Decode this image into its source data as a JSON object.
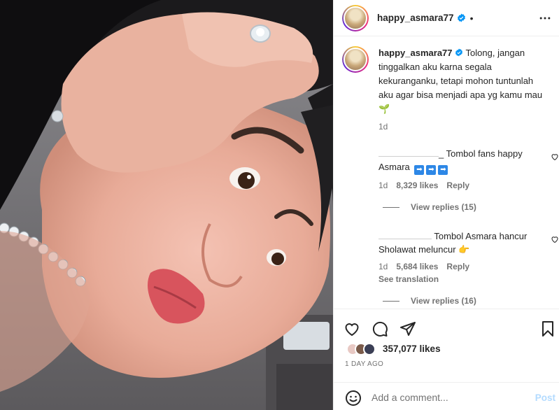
{
  "post": {
    "username": "happy_asmara77",
    "header_separator": "•"
  },
  "caption": {
    "username": "happy_asmara77",
    "text": "Tolong, jangan tinggalkan aku karna segala kekuranganku, tetapi mohon tuntunlah aku agar bisa menjadi apa yg kamu mau",
    "emoji": "🌱",
    "time": "1d"
  },
  "comments": [
    {
      "text_start": "_ Tombol fans happy Asmara",
      "emoji": "➡",
      "time": "1d",
      "likes": "8,329 likes",
      "reply": "Reply",
      "view_replies": "View replies (15)"
    },
    {
      "text_start": "Tombol Asmara hancur Sholawat meluncur",
      "emoji": "👉",
      "time": "1d",
      "likes": "5,684 likes",
      "reply": "Reply",
      "see_translation": "See translation",
      "view_replies": "View replies (16)"
    }
  ],
  "stats": {
    "likes": "357,077 likes",
    "ago": "1 DAY AGO"
  },
  "composer": {
    "placeholder": "Add a comment...",
    "post_label": "Post"
  },
  "colors": {
    "verified": "#0095f6",
    "muted": "#737373",
    "post_disabled": "#b3dbff"
  }
}
